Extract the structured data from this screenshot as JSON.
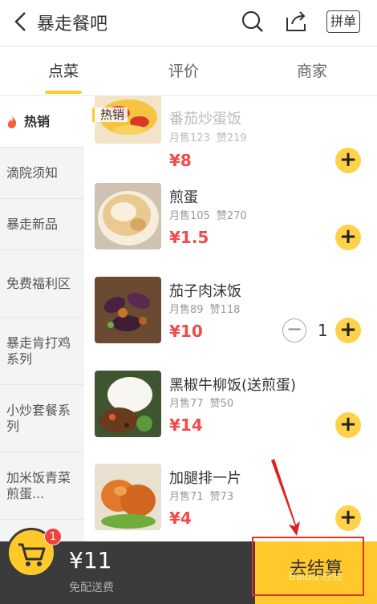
{
  "header": {
    "title": "暴走餐吧",
    "pin_label": "拼单"
  },
  "tabs": [
    {
      "label": "点菜",
      "active": true
    },
    {
      "label": "评价",
      "active": false
    },
    {
      "label": "商家",
      "active": false
    }
  ],
  "sidebar": {
    "items": [
      {
        "label": "热销",
        "active": true,
        "icon": "flame-icon"
      },
      {
        "label": "滴院须知"
      },
      {
        "label": "暴走新品"
      },
      {
        "label": "免费福利区"
      },
      {
        "label": "暴走肯打鸡系列"
      },
      {
        "label": "小炒套餐系列"
      },
      {
        "label": "加米饭青菜煎蛋..."
      }
    ]
  },
  "section": {
    "label": "热销"
  },
  "items": [
    {
      "name": "番茄炒蛋饭",
      "sold": "月售123",
      "likes": "赞219",
      "price": "¥8"
    },
    {
      "name": "煎蛋",
      "sold": "月售105",
      "likes": "赞270",
      "price": "¥1.5"
    },
    {
      "name": "茄子肉沫饭",
      "sold": "月售89",
      "likes": "赞118",
      "price": "¥10",
      "qty": "1"
    },
    {
      "name": "黑椒牛柳饭(送煎蛋)",
      "sold": "月售77",
      "likes": "赞50",
      "price": "¥14"
    },
    {
      "name": "加腿排一片",
      "sold": "月售71",
      "likes": "赞73",
      "price": "¥4"
    }
  ],
  "cart": {
    "badge": "1",
    "total": "¥11",
    "delivery": "免配送费",
    "checkout": "去结算"
  },
  "colors": {
    "accent": "#ffc92b",
    "price": "#f24b4b",
    "bar": "#3b3b3b"
  },
  "watermark": "Baidu 经验"
}
